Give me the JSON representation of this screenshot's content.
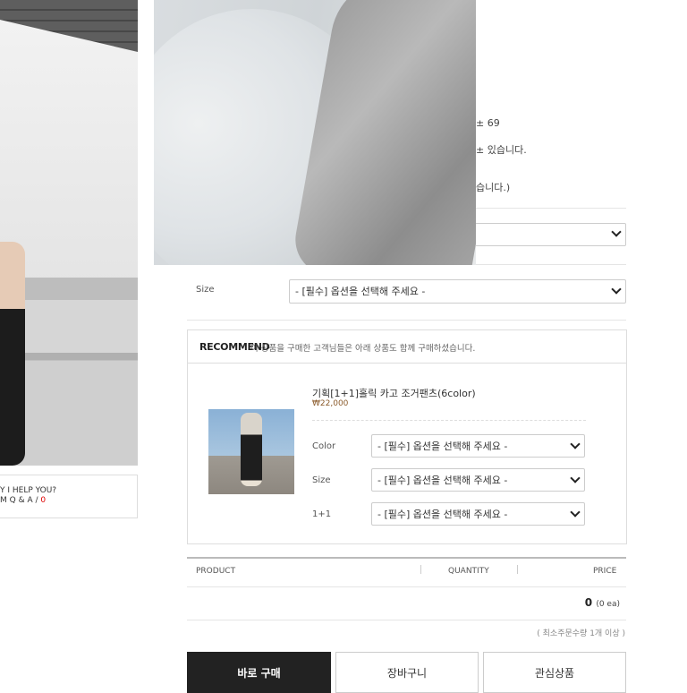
{
  "help_box": {
    "line1": "Y I HELP YOU?",
    "line2": "M Q & A /",
    "count": "0"
  },
  "peek_text": {
    "line1": "± 69",
    "line2": "± 있습니다.",
    "line3": "습니다.)"
  },
  "options": {
    "size_label": "Size",
    "placeholder": "- [필수] 옵션을 선택해 주세요 -"
  },
  "recommend": {
    "title": "RECOMMEND",
    "description": "이 상품을 구매한 고객님들은 아래 상품도 함께 구매하셨습니다.",
    "product_name": "기획[1+1]홀릭 카고 조거팬츠(6color)",
    "product_price": "₩22,000",
    "opt_labels": [
      "Color",
      "Size",
      "1+1"
    ]
  },
  "table": {
    "product": "PRODUCT",
    "quantity": "QUANTITY",
    "price": "PRICE",
    "total": "0",
    "total_unit": "(0 ea)",
    "min_order": "( 최소주문수량 1개 이상 )"
  },
  "buttons": {
    "buy": "바로 구매",
    "cart": "장바구니",
    "wish": "관심상품"
  }
}
